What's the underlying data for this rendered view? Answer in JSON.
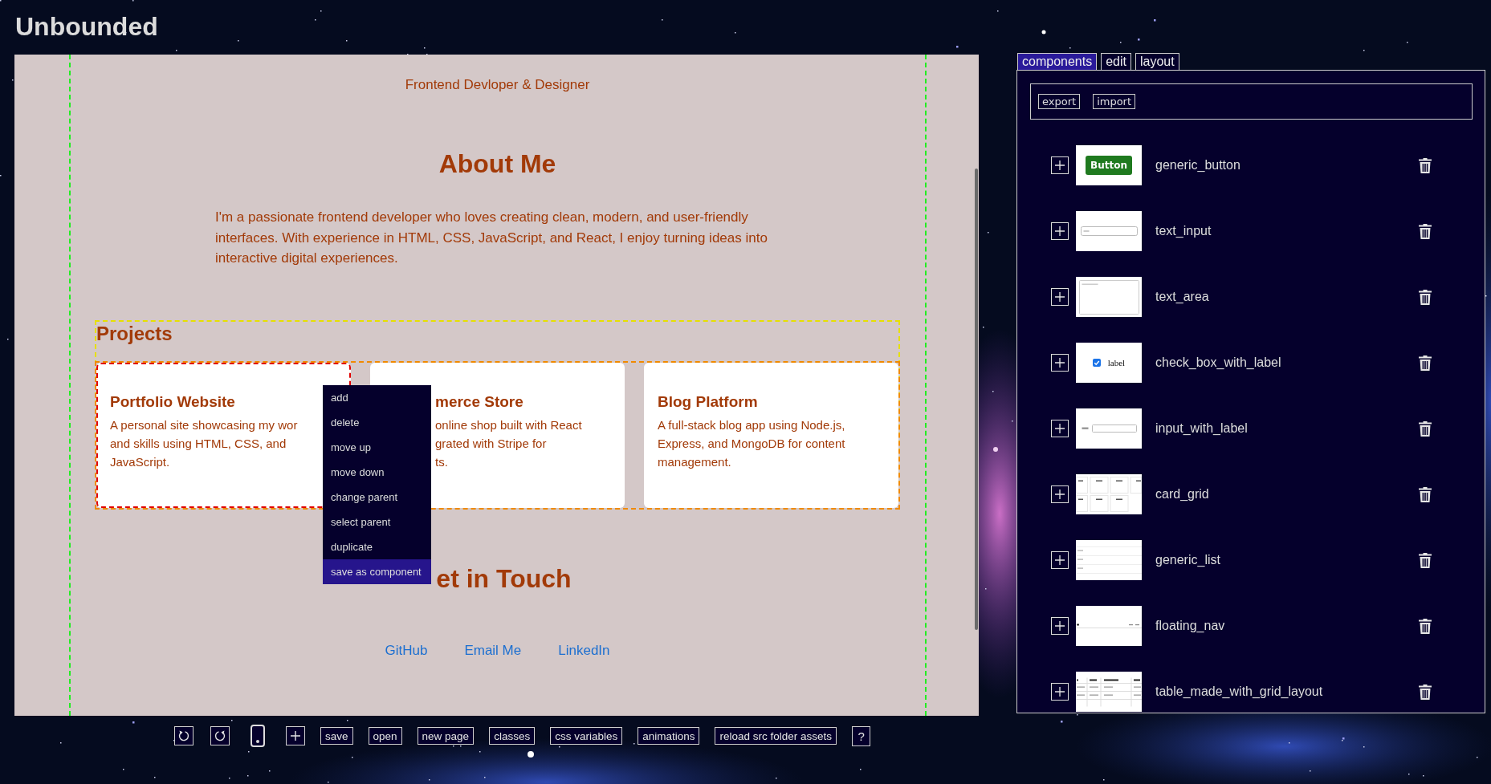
{
  "app": {
    "title": "Unbounded"
  },
  "canvas": {
    "subtitle": "Frontend Devloper & Designer",
    "about": {
      "heading": "About Me",
      "text": "I'm a passionate frontend developer who loves creating clean, modern, and user-friendly interfaces. With experience in HTML, CSS, JavaScript, and React, I enjoy turning ideas into interactive digital experiences."
    },
    "projects": {
      "heading": "Projects",
      "cards": [
        {
          "title": "Portfolio Website",
          "lines": [
            "A personal site showcasing my wor",
            "and skills using HTML, CSS, and",
            "JavaScript."
          ],
          "selected": true
        },
        {
          "title": "merce Store",
          "lines": [
            "online shop built with React",
            "grated with Stripe for",
            "ts."
          ],
          "selected": false
        },
        {
          "title": "Blog Platform",
          "lines": [
            "A full-stack blog app using Node.js,",
            "Express, and MongoDB for content",
            "management."
          ],
          "selected": false
        }
      ]
    },
    "contact": {
      "heading": "et in Touch",
      "links": [
        "GitHub",
        "Email Me",
        "LinkedIn"
      ]
    },
    "context_menu": {
      "items": [
        {
          "label": "add",
          "selected": false
        },
        {
          "label": "delete",
          "selected": false
        },
        {
          "label": "move up",
          "selected": false
        },
        {
          "label": "move down",
          "selected": false
        },
        {
          "label": "change parent",
          "selected": false
        },
        {
          "label": "select parent",
          "selected": false
        },
        {
          "label": "duplicate",
          "selected": false
        },
        {
          "label": "save as component",
          "selected": true
        }
      ]
    }
  },
  "toolbar": {
    "buttons": [
      "save",
      "open",
      "new page",
      "classes",
      "css variables",
      "animations",
      "reload src folder assets",
      "?"
    ]
  },
  "panel": {
    "tabs": [
      {
        "label": "components",
        "selected": true
      },
      {
        "label": "edit",
        "selected": false
      },
      {
        "label": "layout",
        "selected": false
      }
    ],
    "actions": [
      "export",
      "import"
    ],
    "components": [
      {
        "name": "generic_button",
        "preview": {
          "kind": "button",
          "text": "Button"
        }
      },
      {
        "name": "text_input",
        "preview": {
          "kind": "input"
        }
      },
      {
        "name": "text_area",
        "preview": {
          "kind": "textarea"
        }
      },
      {
        "name": "check_box_with_label",
        "preview": {
          "kind": "checkbox",
          "text": "label"
        }
      },
      {
        "name": "input_with_label",
        "preview": {
          "kind": "labeled-input"
        }
      },
      {
        "name": "card_grid",
        "preview": {
          "kind": "card-grid"
        }
      },
      {
        "name": "generic_list",
        "preview": {
          "kind": "list"
        }
      },
      {
        "name": "floating_nav",
        "preview": {
          "kind": "nav"
        }
      },
      {
        "name": "table_made_with_grid_layout",
        "preview": {
          "kind": "table"
        }
      }
    ]
  }
}
